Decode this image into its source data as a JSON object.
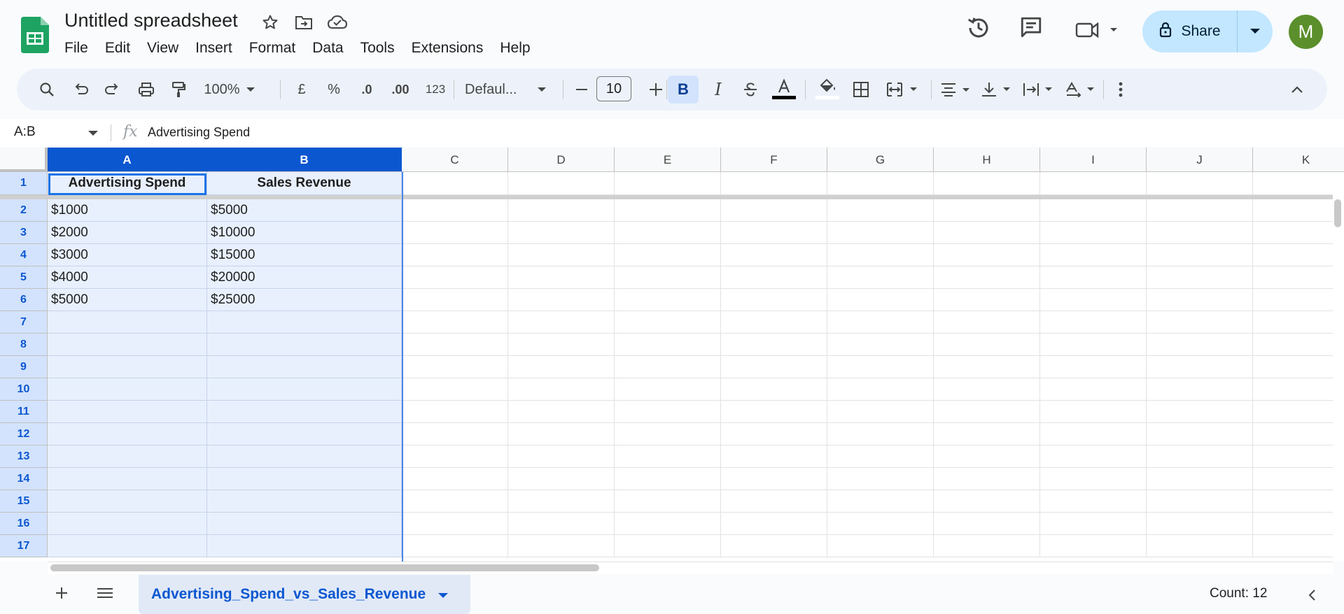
{
  "app": {
    "title": "Untitled spreadsheet",
    "menu": [
      "File",
      "Edit",
      "View",
      "Insert",
      "Format",
      "Data",
      "Tools",
      "Extensions",
      "Help"
    ],
    "share_label": "Share",
    "avatar_initial": "M",
    "accent_color": "#0b57d0",
    "logo_color": "#1ea362"
  },
  "toolbar": {
    "zoom": "100%",
    "currency": "£",
    "percent": "%",
    "dec_decrease": ".0",
    "dec_increase": ".00",
    "number_format": "123",
    "font_name": "Defaul...",
    "font_size": "10"
  },
  "formula_bar": {
    "name_box": "A:B",
    "content": "Advertising Spend"
  },
  "columns": [
    "A",
    "B",
    "C",
    "D",
    "E",
    "F",
    "G",
    "H",
    "I",
    "J",
    "K"
  ],
  "rows": [
    "1",
    "2",
    "3",
    "4",
    "5",
    "6",
    "7",
    "8",
    "9",
    "10",
    "11",
    "12",
    "13",
    "14",
    "15",
    "16",
    "17"
  ],
  "cells": {
    "A1": "Advertising Spend",
    "B1": "Sales Revenue",
    "A2": "$1000",
    "B2": "$5000",
    "A3": "$2000",
    "B3": "$10000",
    "A4": "$3000",
    "B4": "$15000",
    "A5": "$4000",
    "B5": "$20000",
    "A6": "$5000",
    "B6": "$25000"
  },
  "sheet": {
    "tab_name": "Advertising_Spend_vs_Sales_Revenue",
    "status": "Count: 12"
  }
}
